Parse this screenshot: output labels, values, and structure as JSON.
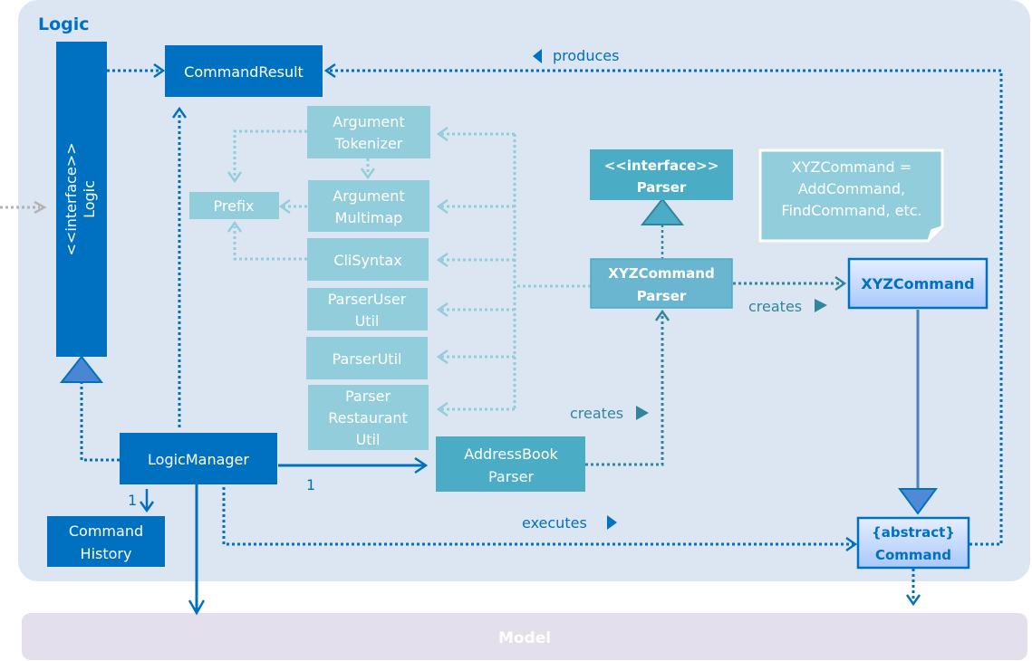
{
  "package": {
    "title": "Logic"
  },
  "classes": {
    "logic_interface": {
      "stereotype": "<<interface>>",
      "name": "Logic"
    },
    "command_result": {
      "name": "CommandResult"
    },
    "argument_tokenizer": {
      "line1": "Argument",
      "line2": "Tokenizer"
    },
    "argument_multimap": {
      "line1": "Argument",
      "line2": "Multimap"
    },
    "prefix": {
      "name": "Prefix"
    },
    "cli_syntax": {
      "name": "CliSyntax"
    },
    "parser_user_util": {
      "line1": "ParserUser",
      "line2": "Util"
    },
    "parser_util": {
      "name": "ParserUtil"
    },
    "parser_restaurant_util": {
      "line1": "Parser",
      "line2": "Restaurant",
      "line3": "Util"
    },
    "parser_interface": {
      "stereotype": "<<interface>>",
      "name": "Parser"
    },
    "xyz_command_parser": {
      "line1": "XYZCommand",
      "line2": "Parser"
    },
    "xyz_command": {
      "name": "XYZCommand"
    },
    "command": {
      "stereotype": "{abstract}",
      "name": "Command"
    },
    "logic_manager": {
      "name": "LogicManager"
    },
    "address_book_parser": {
      "line1": "AddressBook",
      "line2": "Parser"
    },
    "command_history": {
      "line1": "Command",
      "line2": "History"
    }
  },
  "note": {
    "line1": "XYZCommand =",
    "line2": "AddCommand,",
    "line3": "FindCommand, etc."
  },
  "edges": {
    "produces": "produces",
    "creates_command": "creates",
    "creates_parser": "creates",
    "executes": "executes",
    "mult_parser": "1",
    "mult_history": "1"
  },
  "model": {
    "title": "Model"
  },
  "colors": {
    "package_bg": "#dce6f2",
    "dark_blue": "#0070c0",
    "light_teal": "#92cddc",
    "teal": "#4bacc6",
    "model_bg": "#e4dfec"
  }
}
